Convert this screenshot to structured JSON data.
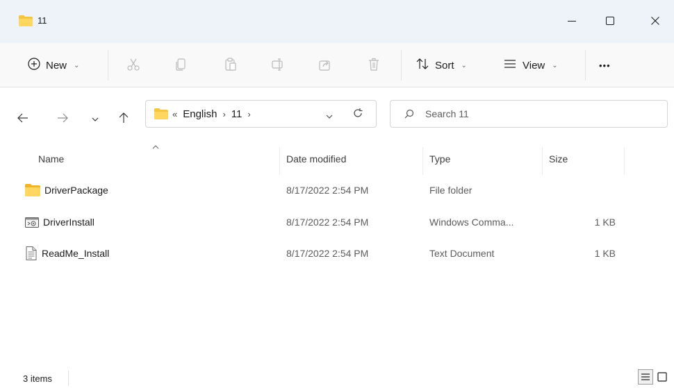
{
  "window": {
    "title": "11",
    "minimize_glyph": "—",
    "maximize_glyph": "☐",
    "close_glyph": "✕"
  },
  "toolbar": {
    "new_label": "New",
    "sort_label": "Sort",
    "view_label": "View",
    "more_label": "•••"
  },
  "address": {
    "overflow": "«",
    "crumbs": [
      "English",
      "11"
    ],
    "sep": "›"
  },
  "search": {
    "placeholder": "Search 11"
  },
  "columns": {
    "name": "Name",
    "date": "Date modified",
    "type": "Type",
    "size": "Size"
  },
  "files": [
    {
      "name": "DriverPackage",
      "date": "8/17/2022 2:54 PM",
      "type": "File folder",
      "size": "",
      "icon": "folder-icon"
    },
    {
      "name": "DriverInstall",
      "date": "8/17/2022 2:54 PM",
      "type": "Windows Comma...",
      "size": "1 KB",
      "icon": "command-script-icon"
    },
    {
      "name": "ReadMe_Install",
      "date": "8/17/2022 2:54 PM",
      "type": "Text Document",
      "size": "1 KB",
      "icon": "text-document-icon"
    }
  ],
  "status": {
    "item_count": "3 items"
  },
  "colors": {
    "titlebar_bg": "#eef3fa",
    "folder_yellow": "#f4c542",
    "accent": "#0067c0"
  }
}
